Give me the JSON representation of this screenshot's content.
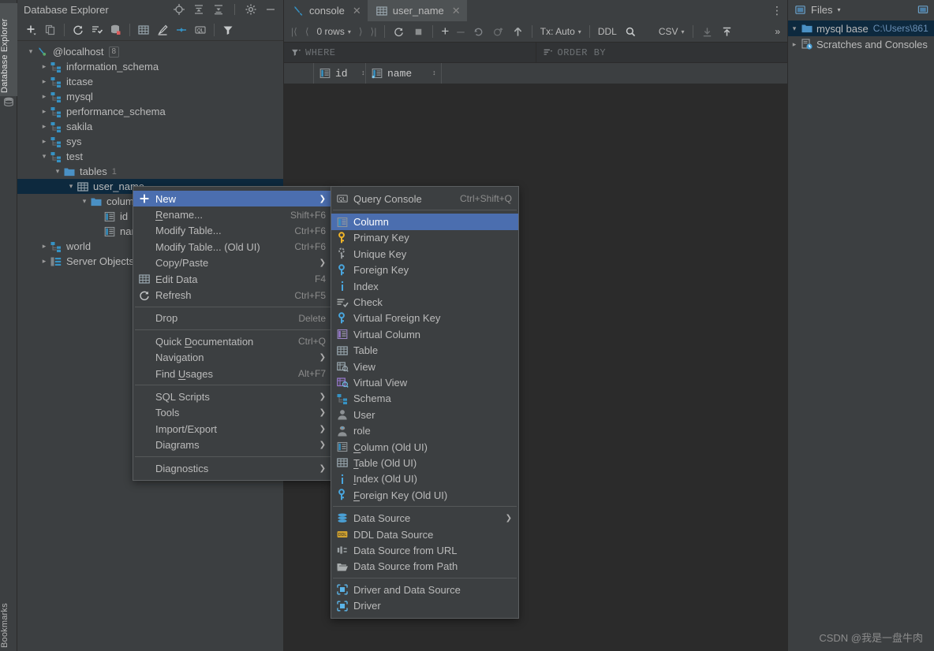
{
  "left_strip": {
    "top_label": "Database Explorer",
    "top_icon": "database-icon",
    "bottom_label": "Bookmarks"
  },
  "db_panel": {
    "title": "Database Explorer",
    "header_icons": [
      {
        "name": "locate-icon",
        "label": "Select in Database Explorer"
      },
      {
        "name": "expand-all-icon",
        "label": "Expand All"
      },
      {
        "name": "collapse-all-icon",
        "label": "Collapse All"
      },
      {
        "name": "gear-icon",
        "label": "Options"
      },
      {
        "name": "minimize-icon",
        "label": "Hide"
      }
    ],
    "toolbar_icons": [
      {
        "name": "add-icon",
        "label": "New"
      },
      {
        "name": "copy-icon",
        "label": "Duplicate"
      },
      {
        "name": "refresh-icon",
        "label": "Refresh"
      },
      {
        "name": "run-sql-icon",
        "label": "Jump to Query Console"
      },
      {
        "name": "database-stop-icon",
        "label": "Disconnect"
      },
      {
        "name": "table-icon",
        "label": "Open Data Editor"
      },
      {
        "name": "modify-icon",
        "label": "Modify Object"
      },
      {
        "name": "sync-icon",
        "label": "Synchronize"
      },
      {
        "name": "query-console-icon",
        "label": "Open Query Console"
      },
      {
        "name": "filter-icon",
        "label": "Filter"
      }
    ],
    "tree": [
      {
        "depth": 0,
        "arrow": "down",
        "icon": "datasource-icon",
        "label": "@localhost",
        "badge": "8",
        "selected": false
      },
      {
        "depth": 1,
        "arrow": "right",
        "icon": "schema-icon",
        "label": "information_schema",
        "selected": false
      },
      {
        "depth": 1,
        "arrow": "right",
        "icon": "schema-icon",
        "label": "itcase",
        "selected": false
      },
      {
        "depth": 1,
        "arrow": "right",
        "icon": "schema-icon",
        "label": "mysql",
        "selected": false
      },
      {
        "depth": 1,
        "arrow": "right",
        "icon": "schema-icon",
        "label": "performance_schema",
        "selected": false
      },
      {
        "depth": 1,
        "arrow": "right",
        "icon": "schema-icon",
        "label": "sakila",
        "selected": false
      },
      {
        "depth": 1,
        "arrow": "right",
        "icon": "schema-icon",
        "label": "sys",
        "selected": false
      },
      {
        "depth": 1,
        "arrow": "down",
        "icon": "schema-icon",
        "label": "test",
        "selected": false
      },
      {
        "depth": 2,
        "arrow": "down",
        "icon": "folder-icon",
        "label": "tables",
        "count": "1",
        "selected": false
      },
      {
        "depth": 3,
        "arrow": "down",
        "icon": "table-icon",
        "label": "user_name",
        "selected": true
      },
      {
        "depth": 4,
        "arrow": "down",
        "icon": "folder-icon",
        "label": "columns",
        "selected": false
      },
      {
        "depth": 5,
        "arrow": "none",
        "icon": "column-icon",
        "label": "id",
        "selected": false
      },
      {
        "depth": 5,
        "arrow": "none",
        "icon": "column-icon",
        "label": "name",
        "selected": false
      },
      {
        "depth": 1,
        "arrow": "right",
        "icon": "schema-icon",
        "label": "world",
        "selected": false
      },
      {
        "depth": 1,
        "arrow": "right",
        "icon": "server-objects-icon",
        "label": "Server Objects",
        "selected": false
      }
    ]
  },
  "editor": {
    "tabs": [
      {
        "label": "console",
        "icon": "console-icon",
        "active": false,
        "closable": true
      },
      {
        "label": "user_name",
        "icon": "table-icon",
        "active": true,
        "closable": true
      }
    ],
    "kebab": "⋮",
    "grid_toolbar": {
      "first_page": "|⟨",
      "prev_page": "⟨",
      "rows_label": "0 rows",
      "next_page": "⟩",
      "last_page": "⟩|",
      "reload": "refresh-icon",
      "stop": "stop-icon",
      "add_row": "+",
      "delete_row": "–",
      "revert": "revert-icon",
      "revert_selected": "revert-selected-icon",
      "submit": "submit-icon",
      "tx_label": "Tx: Auto",
      "ddl_label": "DDL",
      "search_icon": "search-icon",
      "format_label": "CSV",
      "export_icon": "export-icon",
      "import_icon": "import-icon",
      "overflow": "»"
    },
    "filter_bar": {
      "where_icon": "filter-icon",
      "where_label": "WHERE",
      "order_icon": "sort-icon",
      "order_label": "ORDER BY"
    },
    "columns": [
      {
        "label": "id",
        "icon": "column-icon",
        "sort": "↕"
      },
      {
        "label": "name",
        "icon": "column-key-icon",
        "sort": "↕"
      }
    ]
  },
  "files_panel": {
    "title": "Files",
    "caret": "▾",
    "icon": "files-icon",
    "settings_icon": "window-icon",
    "tree": [
      {
        "arrow": "down",
        "icon": "folder-icon",
        "label": "mysql base",
        "path": "C:\\Users\\861",
        "selected": true
      },
      {
        "arrow": "right",
        "icon": "scratches-icon",
        "label": "Scratches and Consoles",
        "selected": false
      }
    ]
  },
  "context_menu": {
    "items": [
      {
        "label": "New",
        "icon": "add-icon",
        "shortcut": "",
        "submenu": true,
        "highlighted": true,
        "mnemonic": ""
      },
      {
        "label": "Rename...",
        "icon": "",
        "shortcut": "Shift+F6",
        "submenu": false,
        "highlighted": false,
        "mnemonic": "R"
      },
      {
        "label": "Modify Table...",
        "icon": "",
        "shortcut": "Ctrl+F6",
        "submenu": false,
        "highlighted": false,
        "mnemonic": ""
      },
      {
        "label": "Modify Table... (Old UI)",
        "icon": "",
        "shortcut": "Ctrl+F6",
        "submenu": false,
        "highlighted": false,
        "mnemonic": ""
      },
      {
        "label": "Copy/Paste",
        "icon": "",
        "shortcut": "",
        "submenu": true,
        "highlighted": false,
        "mnemonic": ""
      },
      {
        "label": "Edit Data",
        "icon": "table-icon",
        "shortcut": "F4",
        "submenu": false,
        "highlighted": false,
        "mnemonic": ""
      },
      {
        "label": "Refresh",
        "icon": "refresh-icon",
        "shortcut": "Ctrl+F5",
        "submenu": false,
        "highlighted": false,
        "mnemonic": ""
      },
      {
        "separator": true
      },
      {
        "label": "Drop",
        "icon": "",
        "shortcut": "Delete",
        "submenu": false,
        "highlighted": false,
        "mnemonic": ""
      },
      {
        "separator": true
      },
      {
        "label": "Quick Documentation",
        "icon": "",
        "shortcut": "Ctrl+Q",
        "submenu": false,
        "highlighted": false,
        "mnemonic": "D"
      },
      {
        "label": "Navigation",
        "icon": "",
        "shortcut": "",
        "submenu": true,
        "highlighted": false,
        "mnemonic": ""
      },
      {
        "label": "Find Usages",
        "icon": "",
        "shortcut": "Alt+F7",
        "submenu": false,
        "highlighted": false,
        "mnemonic": "U"
      },
      {
        "separator": true
      },
      {
        "label": "SQL Scripts",
        "icon": "",
        "shortcut": "",
        "submenu": true,
        "highlighted": false,
        "mnemonic": ""
      },
      {
        "label": "Tools",
        "icon": "",
        "shortcut": "",
        "submenu": true,
        "highlighted": false,
        "mnemonic": ""
      },
      {
        "label": "Import/Export",
        "icon": "",
        "shortcut": "",
        "submenu": true,
        "highlighted": false,
        "mnemonic": ""
      },
      {
        "label": "Diagrams",
        "icon": "",
        "shortcut": "",
        "submenu": true,
        "highlighted": false,
        "mnemonic": ""
      },
      {
        "separator": true
      },
      {
        "label": "Diagnostics",
        "icon": "",
        "shortcut": "",
        "submenu": true,
        "highlighted": false,
        "mnemonic": ""
      }
    ]
  },
  "new_submenu": {
    "items": [
      {
        "label": "Query Console",
        "icon": "query-console-icon",
        "shortcut": "Ctrl+Shift+Q",
        "submenu": false,
        "highlighted": false
      },
      {
        "separator": true
      },
      {
        "label": "Column",
        "icon": "column-icon",
        "shortcut": "",
        "submenu": false,
        "highlighted": true
      },
      {
        "label": "Primary Key",
        "icon": "key-yellow-icon",
        "shortcut": "",
        "submenu": false,
        "highlighted": false
      },
      {
        "label": "Unique Key",
        "icon": "key-gray-icon",
        "shortcut": "",
        "submenu": false,
        "highlighted": false
      },
      {
        "label": "Foreign Key",
        "icon": "key-blue-icon",
        "shortcut": "",
        "submenu": false,
        "highlighted": false
      },
      {
        "label": "Index",
        "icon": "index-icon",
        "shortcut": "",
        "submenu": false,
        "highlighted": false
      },
      {
        "label": "Check",
        "icon": "check-icon",
        "shortcut": "",
        "submenu": false,
        "highlighted": false
      },
      {
        "label": "Virtual Foreign Key",
        "icon": "key-blue-icon",
        "shortcut": "",
        "submenu": false,
        "highlighted": false
      },
      {
        "label": "Virtual Column",
        "icon": "virtual-column-icon",
        "shortcut": "",
        "submenu": false,
        "highlighted": false
      },
      {
        "label": "Table",
        "icon": "table-icon",
        "shortcut": "",
        "submenu": false,
        "highlighted": false
      },
      {
        "label": "View",
        "icon": "view-icon",
        "shortcut": "",
        "submenu": false,
        "highlighted": false
      },
      {
        "label": "Virtual View",
        "icon": "virtual-view-icon",
        "shortcut": "",
        "submenu": false,
        "highlighted": false
      },
      {
        "label": "Schema",
        "icon": "schema-icon",
        "shortcut": "",
        "submenu": false,
        "highlighted": false
      },
      {
        "label": "User",
        "icon": "user-icon",
        "shortcut": "",
        "submenu": false,
        "highlighted": false
      },
      {
        "label": "role",
        "icon": "role-icon",
        "shortcut": "",
        "submenu": false,
        "highlighted": false
      },
      {
        "label": "Column (Old UI)",
        "icon": "column-icon",
        "shortcut": "",
        "submenu": false,
        "highlighted": false,
        "mnemonic": "C"
      },
      {
        "label": "Table (Old UI)",
        "icon": "table-icon",
        "shortcut": "",
        "submenu": false,
        "highlighted": false,
        "mnemonic": "T"
      },
      {
        "label": "Index (Old UI)",
        "icon": "index-icon",
        "shortcut": "",
        "submenu": false,
        "highlighted": false,
        "mnemonic": "I"
      },
      {
        "label": "Foreign Key (Old UI)",
        "icon": "key-blue-icon",
        "shortcut": "",
        "submenu": false,
        "highlighted": false,
        "mnemonic": "F"
      },
      {
        "separator": true
      },
      {
        "label": "Data Source",
        "icon": "datasource-stack-icon",
        "shortcut": "",
        "submenu": true,
        "highlighted": false
      },
      {
        "label": "DDL Data Source",
        "icon": "ddl-icon",
        "shortcut": "",
        "submenu": false,
        "highlighted": false
      },
      {
        "label": "Data Source from URL",
        "icon": "url-icon",
        "shortcut": "",
        "submenu": false,
        "highlighted": false
      },
      {
        "label": "Data Source from Path",
        "icon": "folder-open-icon",
        "shortcut": "",
        "submenu": false,
        "highlighted": false
      },
      {
        "separator": true
      },
      {
        "label": "Driver and Data Source",
        "icon": "driver-icon",
        "shortcut": "",
        "submenu": false,
        "highlighted": false
      },
      {
        "label": "Driver",
        "icon": "driver-icon",
        "shortcut": "",
        "submenu": false,
        "highlighted": false
      }
    ]
  },
  "watermark": "CSDN @我是一盘牛肉",
  "colors": {
    "panel_bg": "#3c3f41",
    "editor_bg": "#2b2b2b",
    "selection_blue": "#4b6eaf",
    "tree_selection": "#0d293e",
    "accent_blue": "#3592c4",
    "text": "#bbbbbb",
    "muted_text": "#808080",
    "path_blue": "#6a8fb5"
  }
}
